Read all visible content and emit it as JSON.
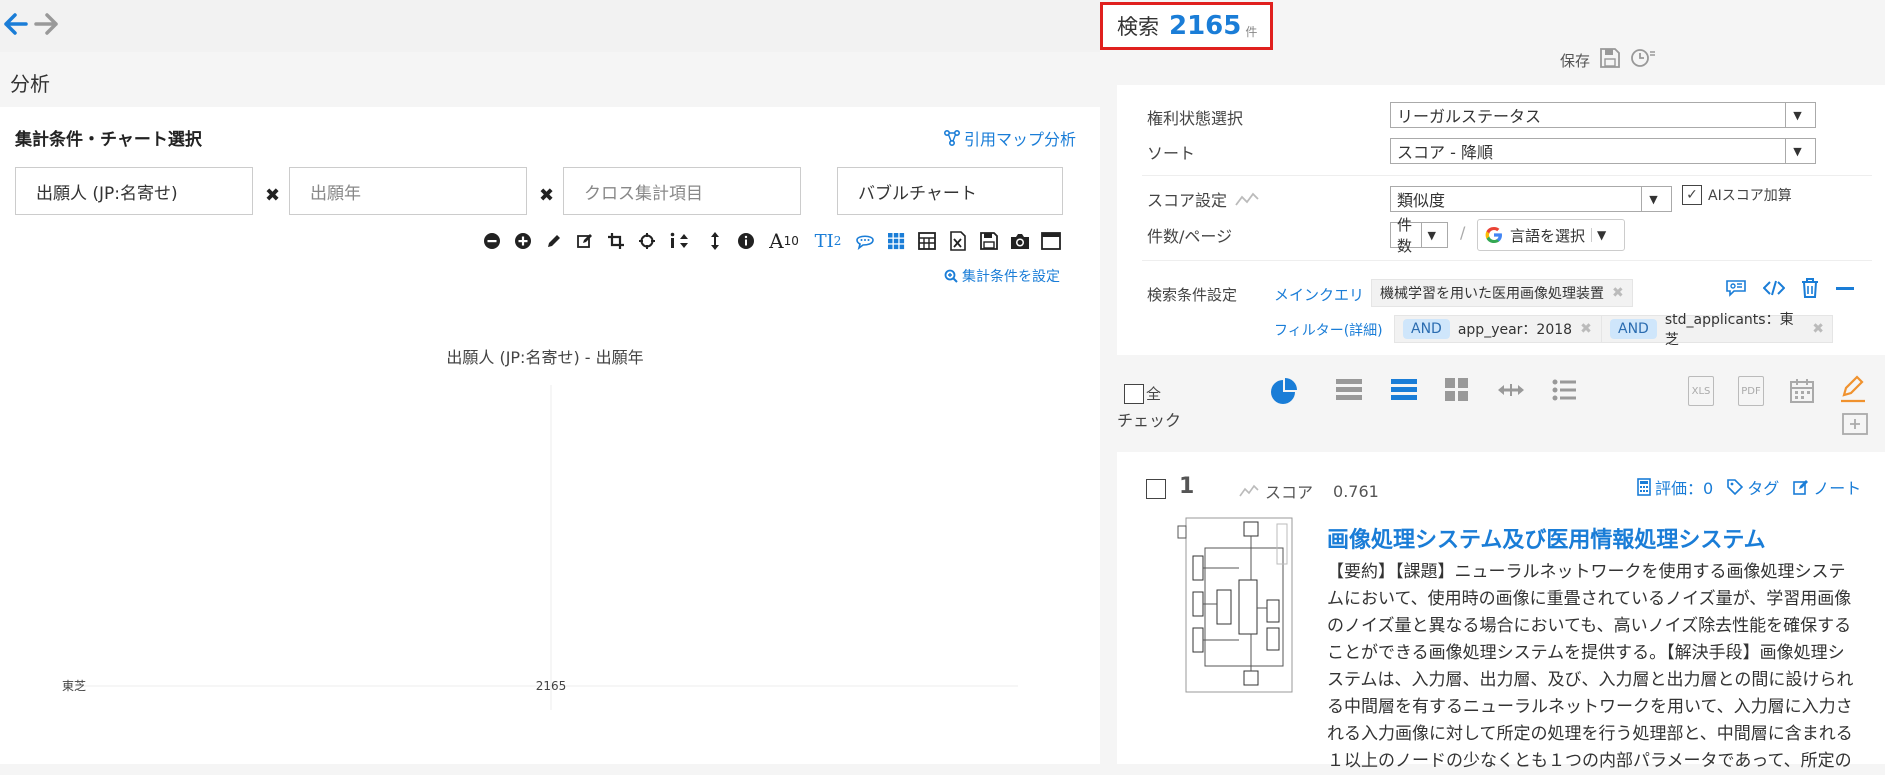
{
  "nav": {
    "back_icon": "arrow-left-icon",
    "forward_icon": "arrow-right-icon"
  },
  "left": {
    "header": "分析",
    "section_title": "集計条件・チャート選択",
    "citation_map_link": "引用マップ分析",
    "field1": "出願人 (JP:名寄せ)",
    "field2_placeholder": "出願年",
    "field3_placeholder": "クロス集計項目",
    "chart_type": "バブルチャート",
    "times": "✖",
    "toolbar": {
      "font_size": "10",
      "tl_label": "TI",
      "tl_num": "2"
    },
    "set_condition_link": "集計条件を設定",
    "chart_title": "出願人 (JP:名寄せ) - 出願年"
  },
  "chart_data": {
    "type": "scatter",
    "title": "出願人 (JP:名寄せ) - 出願年",
    "categories": [
      "東芝"
    ],
    "values": [
      2165
    ],
    "xlabel": "",
    "ylabel": ""
  },
  "search": {
    "label": "検索",
    "count": "2165",
    "unit": "件",
    "save_label": "保存"
  },
  "conditions": {
    "rights_label": "権利状態選択",
    "rights_value": "リーガルステータス",
    "sort_label": "ソート",
    "sort_value": "スコア - 降順",
    "score_label": "スコア設定",
    "score_value": "類似度",
    "ai_score_label": "AIスコア加算",
    "per_page_label": "件数/ページ",
    "per_page_value": "件数",
    "slash": "/",
    "language_label": "言語を選択",
    "search_cond_label": "検索条件設定",
    "main_query_label": "メインクエリ",
    "main_query_value": "機械学習を用いた医用画像処理装置",
    "filter_label": "フィルター(詳細)",
    "filters": [
      {
        "op": "AND",
        "text": "app_year：2018"
      },
      {
        "op": "AND",
        "text": "std_applicants：東芝"
      }
    ]
  },
  "viewbar": {
    "check_all_line1": "全",
    "check_all_line2": "チェック",
    "xls": "XLS",
    "pdf": "PDF"
  },
  "result": {
    "index": "1",
    "score_label": "スコア",
    "score_value": "0.761",
    "rating_label": "評価：0",
    "tag_label": "タグ",
    "note_label": "ノート",
    "title": "画像処理システム及び医用情報処理システム",
    "abstract_lines": [
      "【要約】【課題】ニューラルネットワークを使用する画像処理システ",
      "ムにおいて、使用時の画像に重畳されているノイズ量が、学習用画像",
      "のノイズ量と異なる場合においても、高いノイズ除去性能を確保する",
      "ことができる画像処理システムを提供する。【解決手段】画像処理シ",
      "ステムは、入力層、出力層、及び、入力層と出力層との間に設けられ",
      "る中間層を有するニューラルネットワークを用いて、入力層に入力さ",
      "れる入力画像に対して所定の処理を行う処理部と、中間層に含まれる",
      "１以上のノードの少なくとも１つの内部パラメータであって、所定の"
    ]
  },
  "colors": {
    "accent": "#1a7dd7",
    "highlight_border": "#e0201e",
    "and_chip": "#cfe6fb",
    "pen": "#f0922e"
  }
}
